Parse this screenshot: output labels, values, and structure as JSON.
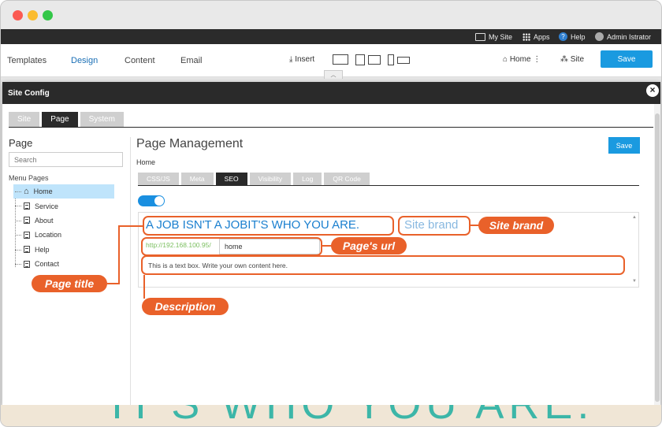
{
  "adminbar": {
    "my_site": "My Site",
    "apps": "Apps",
    "help": "Help",
    "user": "Admin Istrator"
  },
  "toolbar": {
    "tabs": [
      "Templates",
      "Design",
      "Content",
      "Email"
    ],
    "active_tab": "Design",
    "insert": "Insert",
    "home": "Home",
    "site": "Site",
    "save": "Save"
  },
  "modal": {
    "title": "Site Config",
    "close": "×",
    "tabs": [
      "Site",
      "Page",
      "System"
    ],
    "active_tab": "Page",
    "sidebar": {
      "title": "Page",
      "search_placeholder": "Search",
      "menu_label": "Menu Pages",
      "items": [
        "Home",
        "Service",
        "About",
        "Location",
        "Help",
        "Contact"
      ]
    },
    "main": {
      "title": "Page Management",
      "save": "Save",
      "breadcrumb": "Home",
      "sub_tabs": [
        "CSS/JS",
        "Meta",
        "SEO",
        "Visibility",
        "Log",
        "QR Code"
      ],
      "active_sub_tab": "SEO",
      "page_title": "A JOB ISN'T A JOBIT'S WHO YOU ARE.",
      "site_brand": "Site brand",
      "url_prefix": "http://192.168.100.95/",
      "url_value": "home",
      "description": "This is a text box. Write your own content here."
    }
  },
  "annotations": {
    "site_brand": "Site brand",
    "page_url": "Page's url",
    "page_title": "Page title",
    "description": "Description",
    "color": "#e9612a"
  },
  "background_text": "IT'S WHO YOU ARE."
}
